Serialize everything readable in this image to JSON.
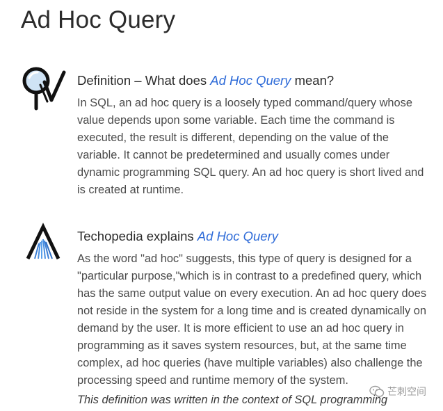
{
  "page": {
    "title": "Ad Hoc Query"
  },
  "definition": {
    "heading_prefix": "Definition – What does ",
    "heading_link": "Ad Hoc Query",
    "heading_suffix": " mean?",
    "lines": [
      "In SQL, an ad hoc query is a loosely typed command/query whose",
      "value depends upon some variable. Each time the command is",
      "executed, the result is different, depending on the value of the",
      "variable. It cannot be predetermined and usually comes under",
      "dynamic programming SQL query. An ad hoc query is short lived and",
      "is created at runtime."
    ],
    "logo_icon": "magnifier-check-icon"
  },
  "explains": {
    "heading_prefix": "Techopedia explains ",
    "heading_link": "Ad Hoc Query",
    "lines": [
      "As the word \"ad hoc\" suggests, this type of query is designed for a",
      "\"particular purpose,\"which is in contrast to a predefined query, which",
      "has the same output value on every execution. An ad hoc query does",
      "not reside in the system for a long time and is created dynamically on",
      "demand by the user. It is more efficient to use an ad hoc query in",
      "programming as it saves system resources, but, at the same time",
      "complex, ad hoc queries (have multiple variables) also challenge the",
      "processing speed and runtime memory of the system."
    ],
    "note": "This definition was written in the context of SQL programming",
    "logo_icon": "techopedia-a-icon"
  },
  "watermark": {
    "text": "芒刺空间",
    "icon": "wechat-icon"
  },
  "colors": {
    "link": "#2e6bd8",
    "text": "#4a4a4a",
    "heading": "#2b2b2b"
  }
}
